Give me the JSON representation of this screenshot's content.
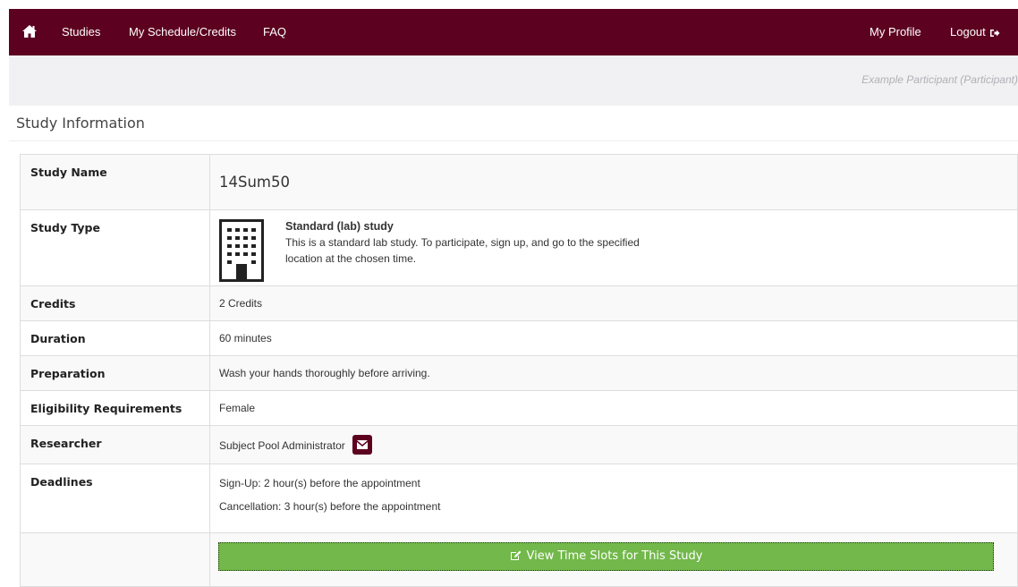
{
  "nav": {
    "home_icon": "home-icon",
    "links": [
      "Studies",
      "My Schedule/Credits",
      "FAQ"
    ],
    "profile": "My Profile",
    "logout": "Logout",
    "logout_icon": "sign-out-icon",
    "background": "#5c0120"
  },
  "user": {
    "text": "Example Participant (Participant)"
  },
  "page": {
    "heading": "Study Information"
  },
  "study": {
    "rows": [
      {
        "label": "Study Name",
        "value": "14Sum50"
      },
      {
        "label": "Study Type",
        "type_title": "Standard (lab) study",
        "type_desc": "This is a standard lab study. To participate, sign up, and go to the specified location at the chosen time.",
        "icon": "building-icon"
      },
      {
        "label": "Credits",
        "value": "2 Credits"
      },
      {
        "label": "Duration",
        "value": "60 minutes"
      },
      {
        "label": "Preparation",
        "value": "Wash your hands thoroughly before arriving."
      },
      {
        "label": "Eligibility Requirements",
        "value": "Female"
      },
      {
        "label": "Researcher",
        "value": "Subject Pool Administrator",
        "icon": "envelope-icon"
      },
      {
        "label": "Deadlines",
        "signup": "Sign-Up:  2 hour(s) before the appointment",
        "cancellation": "Cancellation:  3 hour(s) before the appointment"
      }
    ]
  },
  "actions": {
    "view_slots": "View Time Slots for This Study",
    "view_slots_icon": "edit-icon",
    "button_color": "#72b84a"
  }
}
